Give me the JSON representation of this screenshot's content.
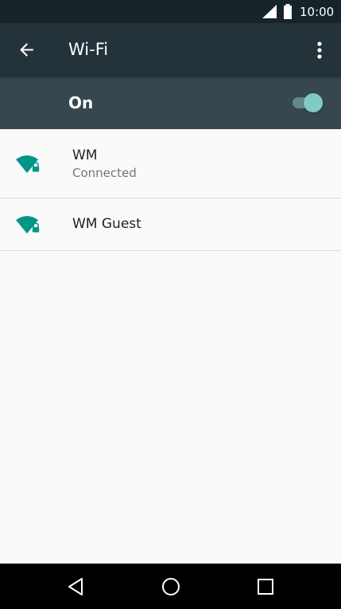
{
  "status_bar": {
    "time": "10:00",
    "icons": [
      "cell-signal-icon",
      "battery-icon"
    ]
  },
  "app_bar": {
    "title": "Wi-Fi",
    "icons": [
      "back-arrow-icon",
      "more-vert-icon"
    ]
  },
  "master_switch": {
    "label": "On",
    "checked": true,
    "track_color": "#5f8a88",
    "thumb_color": "#80cbc4"
  },
  "networks": [
    {
      "ssid": "WM",
      "status": "Connected",
      "icon": "wifi-lock-icon",
      "secured": true
    },
    {
      "ssid": "WM Guest",
      "icon": "wifi-lock-icon",
      "secured": true
    }
  ],
  "nav_bar": {
    "icons": [
      "back-triangle-icon",
      "home-circle-icon",
      "recents-square-icon"
    ]
  },
  "colors": {
    "status_bar_bg": "#16242a",
    "app_bar_bg": "#243239",
    "switch_bar_bg": "#37474f",
    "accent": "#009688",
    "list_bg": "#fafafa",
    "nav_bar_bg": "#000000"
  }
}
